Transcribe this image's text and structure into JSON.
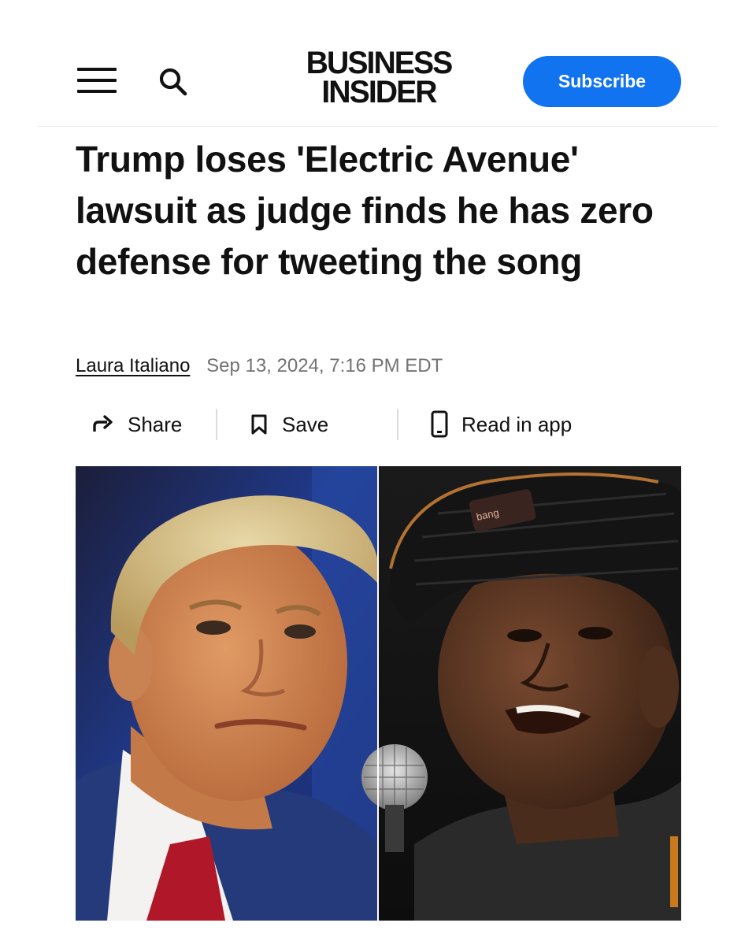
{
  "header": {
    "logo_line1": "BUSINESS",
    "logo_line2": "INSIDER",
    "subscribe_label": "Subscribe",
    "icons": [
      "menu-icon",
      "search-icon"
    ],
    "accent_color": "#1273f0"
  },
  "article": {
    "headline": "Trump loses 'Electric Avenue' lawsuit as judge finds he has zero defense for tweeting the song",
    "author": "Laura Italiano",
    "date": "Sep 13, 2024, 7:16 PM EDT"
  },
  "actions": {
    "share_label": "Share",
    "save_label": "Save",
    "read_in_app_label": "Read in app"
  },
  "image": {
    "cap_text": "bang"
  }
}
